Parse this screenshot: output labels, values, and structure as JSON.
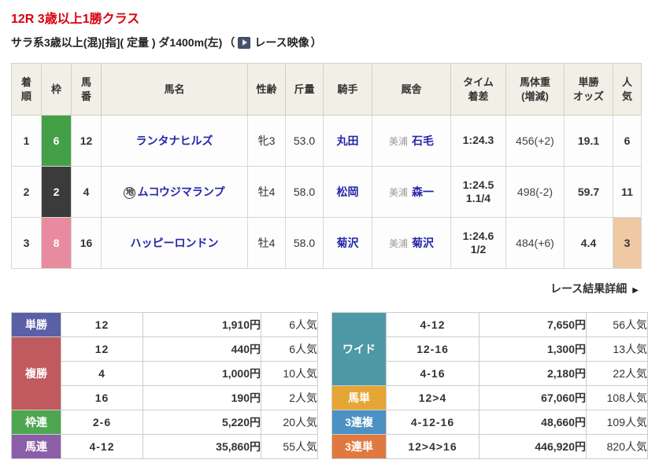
{
  "header": {
    "title": "12R 3歳以上1勝クラス",
    "title_color": "#d7000f",
    "conditions": "サラ系3歳以上(混)[指]( 定量 ) ダ1400m(左)",
    "paren_open": "（",
    "video_label": "レース映像",
    "paren_close": "）"
  },
  "results": {
    "columns": [
      "着\n順",
      "枠",
      "馬\n番",
      "馬名",
      "性齢",
      "斤量",
      "騎手",
      "厩舎",
      "タイム\n着差",
      "馬体重\n(増減)",
      "単勝\nオッズ",
      "人\n気"
    ],
    "detail_link": "レース結果詳細",
    "detail_arrow": "▶",
    "rows": [
      {
        "pos": "1",
        "waku": "6",
        "waku_color": "#43a047",
        "num": "12",
        "mark": "",
        "name": "ランタナヒルズ",
        "sexage": "牝3",
        "weight": "53.0",
        "jockey": "丸田",
        "stable_area": "美浦",
        "trainer": "石毛",
        "time": "1:24.3",
        "margin": "",
        "body_weight": "456(+2)",
        "odds": "19.1",
        "fav": "6",
        "fav_bg": ""
      },
      {
        "pos": "2",
        "waku": "2",
        "waku_color": "#3b3b3b",
        "num": "4",
        "mark": "地",
        "name": "ムコウジマランプ",
        "sexage": "牡4",
        "weight": "58.0",
        "jockey": "松岡",
        "stable_area": "美浦",
        "trainer": "森一",
        "time": "1:24.5",
        "margin": "1.1/4",
        "body_weight": "498(-2)",
        "odds": "59.7",
        "fav": "11",
        "fav_bg": ""
      },
      {
        "pos": "3",
        "waku": "8",
        "waku_color": "#e88b9e",
        "num": "16",
        "mark": "",
        "name": "ハッピーロンドン",
        "sexage": "牡4",
        "weight": "58.0",
        "jockey": "菊沢",
        "stable_area": "美浦",
        "trainer": "菊沢",
        "time": "1:24.6",
        "margin": "1/2",
        "body_weight": "484(+6)",
        "odds": "4.4",
        "fav": "3",
        "fav_bg": "#efc9a4"
      }
    ]
  },
  "payouts": {
    "left": [
      {
        "label": "単勝",
        "color": "#5a60a6",
        "rows": [
          {
            "combo": "12",
            "amount": "1,910円",
            "fav": "6人気"
          }
        ]
      },
      {
        "label": "複勝",
        "color": "#bf5a5e",
        "rows": [
          {
            "combo": "12",
            "amount": "440円",
            "fav": "6人気"
          },
          {
            "combo": "4",
            "amount": "1,000円",
            "fav": "10人気"
          },
          {
            "combo": "16",
            "amount": "190円",
            "fav": "2人気"
          }
        ]
      },
      {
        "label": "枠連",
        "color": "#4ea651",
        "rows": [
          {
            "combo": "2-6",
            "amount": "5,220円",
            "fav": "20人気"
          }
        ]
      },
      {
        "label": "馬連",
        "color": "#8b5fa8",
        "rows": [
          {
            "combo": "4-12",
            "amount": "35,860円",
            "fav": "55人気"
          }
        ]
      }
    ],
    "right": [
      {
        "label": "ワイド",
        "color": "#4d99a5",
        "rows": [
          {
            "combo": "4-12",
            "amount": "7,650円",
            "fav": "56人気"
          },
          {
            "combo": "12-16",
            "amount": "1,300円",
            "fav": "13人気"
          },
          {
            "combo": "4-16",
            "amount": "2,180円",
            "fav": "22人気"
          }
        ]
      },
      {
        "label": "馬単",
        "color": "#e5a635",
        "rows": [
          {
            "combo": "12>4",
            "amount": "67,060円",
            "fav": "108人気"
          }
        ]
      },
      {
        "label": "3連複",
        "color": "#4d90c4",
        "rows": [
          {
            "combo": "4-12-16",
            "amount": "48,660円",
            "fav": "109人気"
          }
        ]
      },
      {
        "label": "3連単",
        "color": "#e0793f",
        "rows": [
          {
            "combo": "12>4>16",
            "amount": "446,920円",
            "fav": "820人気"
          }
        ]
      }
    ]
  }
}
